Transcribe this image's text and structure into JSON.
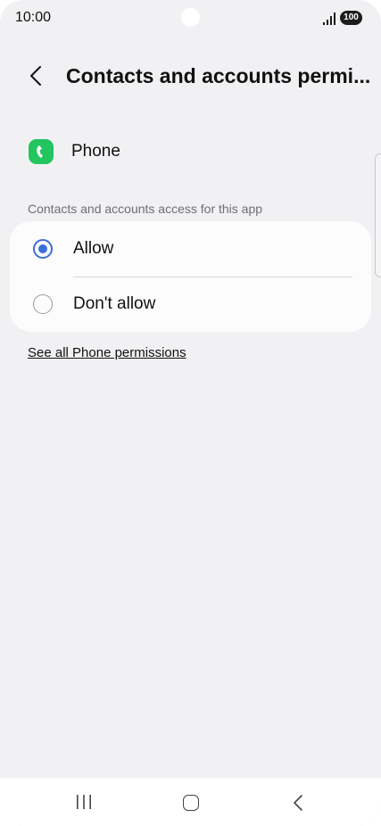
{
  "status_bar": {
    "time": "10:00",
    "battery": "100"
  },
  "header": {
    "title": "Contacts and accounts permi..."
  },
  "app": {
    "name": "Phone",
    "icon": "phone-icon",
    "icon_color": "#22c55e"
  },
  "section": {
    "label": "Contacts and accounts access for this app"
  },
  "options": [
    {
      "label": "Allow",
      "selected": true
    },
    {
      "label": "Don't allow",
      "selected": false
    }
  ],
  "link": {
    "label": "See all Phone permissions"
  },
  "colors": {
    "accent": "#3b6fd8",
    "background": "#f1f1f3"
  }
}
